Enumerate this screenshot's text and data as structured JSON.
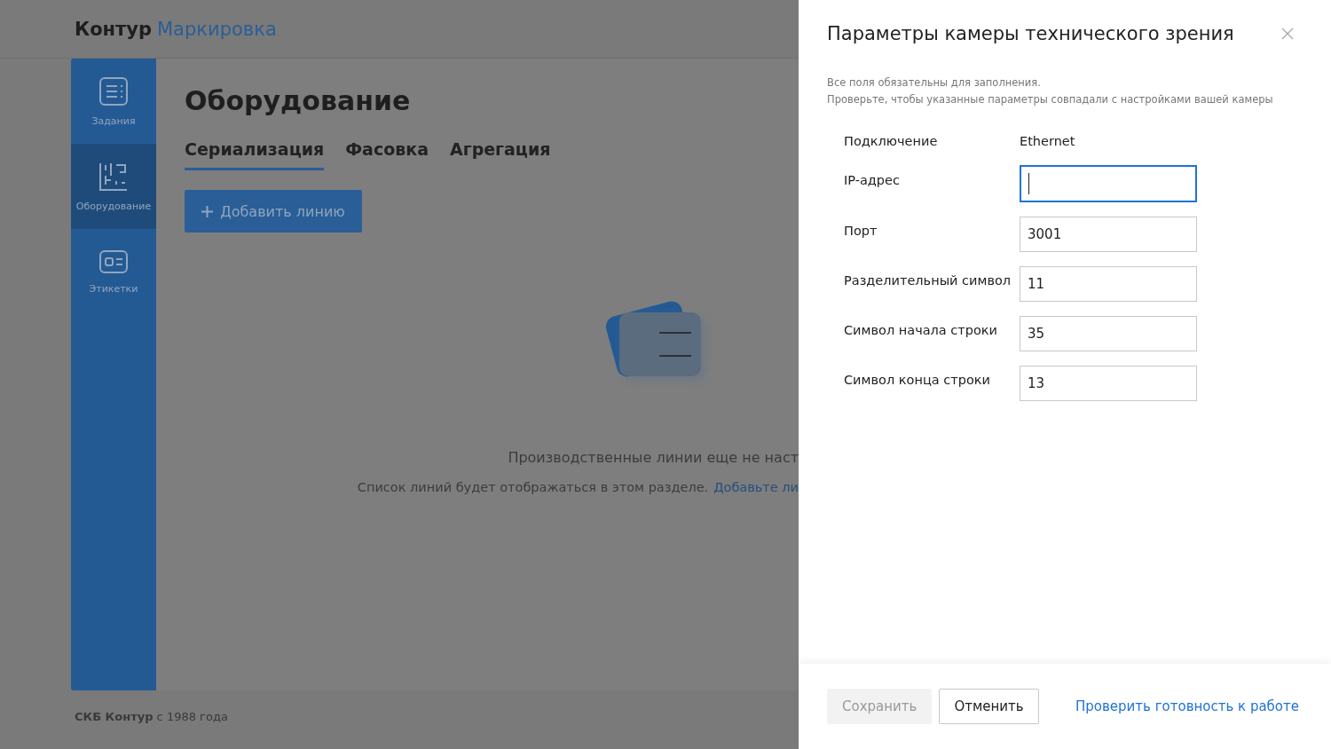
{
  "header": {
    "brand": "Контур",
    "product": "Маркировка"
  },
  "sidebar": {
    "items": [
      {
        "label": "Задания",
        "kind": "tasks",
        "selected": false
      },
      {
        "label": "Оборудование",
        "kind": "equipment",
        "selected": true
      },
      {
        "label": "Этикетки",
        "kind": "labels",
        "selected": false
      }
    ]
  },
  "page": {
    "title": "Оборудование",
    "tabs": [
      {
        "label": "Сериализация",
        "selected": true
      },
      {
        "label": "Фасовка",
        "selected": false
      },
      {
        "label": "Агрегация",
        "selected": false
      }
    ],
    "add_button": "Добавить линию",
    "empty_title": "Производственные линии еще не наст",
    "empty_text": "Список линий будет отображаться в этом разделе.",
    "empty_link": "Добавьте ли"
  },
  "footer": {
    "company": "СКБ Контур",
    "since": "с 1988 года"
  },
  "panel": {
    "title": "Параметры камеры технического зрения",
    "notes": [
      "Все поля обязательны для заполнения.",
      "Проверьте, чтобы указанные параметры совпадали с настройками вашей камеры"
    ],
    "fields": [
      {
        "label": "Подключение",
        "kind": "text",
        "value": "Ethernet"
      },
      {
        "label": "IP-адрес",
        "kind": "input",
        "focused": true
      },
      {
        "label": "Порт",
        "kind": "input",
        "value": "3001",
        "focused": false
      },
      {
        "label": "Разделительный символ",
        "kind": "input",
        "value": "11",
        "focused": false
      },
      {
        "label": "Символ начала строки",
        "kind": "input",
        "value": "35",
        "focused": false
      },
      {
        "label": "Символ конца строки",
        "kind": "input",
        "value": "13",
        "focused": false
      }
    ],
    "buttons": [
      {
        "label": "Сохранить",
        "disabled": true
      },
      {
        "label": "Отменить",
        "disabled": false
      }
    ],
    "link": "Проверить готовность к работе"
  }
}
